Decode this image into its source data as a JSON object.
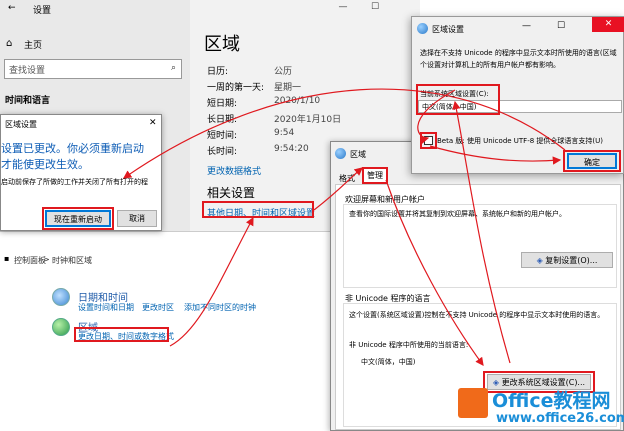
{
  "settings": {
    "title": "设置",
    "home": "主页",
    "search_placeholder": "查找设置",
    "section": "时间和语言",
    "region_title": "区域",
    "rows": [
      {
        "label": "日历:",
        "value": "公历"
      },
      {
        "label": "一周的第一天:",
        "value": "星期一"
      },
      {
        "label": "短日期:",
        "value": "2020/1/10"
      },
      {
        "label": "长日期:",
        "value": "2020年1月10日"
      },
      {
        "label": "短时间:",
        "value": "9:54"
      },
      {
        "label": "长时间:",
        "value": "9:54:20"
      }
    ],
    "change_format": "更改数据格式",
    "related_title": "相关设置",
    "related_link": "其他日期、时间和区域设置",
    "window_buttons": {
      "minimize": "—",
      "maximize": "☐"
    }
  },
  "alert": {
    "title": "区域设置",
    "message_line1": "设置已更改。你必须重新启动",
    "message_line2": "才能使更改生效。",
    "note": "启动前保存了所做的工作并关闭了所有打开的程",
    "restart_label": "现在重新启动",
    "cancel_label": "取消",
    "close": "✕"
  },
  "control_panel": {
    "breadcrumb_1": "控制面板",
    "breadcrumb_sep": ">",
    "breadcrumb_2": "时钟和区域",
    "datetime_title": "日期和时间",
    "datetime_links": [
      "设置时间和日期",
      "更改时区",
      "添加不同时区的时钟"
    ],
    "region_title": "区域",
    "region_link": "更改日期、时间或数字格式"
  },
  "region_dialog": {
    "title": "区域",
    "tabs": [
      "格式",
      "管理"
    ],
    "welcome_title": "欢迎屏幕和新用户帐户",
    "welcome_desc": "查看你的国际设置并将其复制到欢迎屏幕、系统帐户和新的用户帐户。",
    "copy_button": "复制设置(O)...",
    "unicode_title": "非 Unicode 程序的语言",
    "unicode_desc": "这个设置(系统区域设置)控制在不支持 Unicode 的程序中显示文本时使用的语言。",
    "current_label": "非 Unicode 程序中所使用的当前语言:",
    "current_value": "中文(简体，中国)",
    "change_button": "更改系统区域设置(C)..."
  },
  "unicode_dialog": {
    "title": "区域设置",
    "desc_line1": "选择在不支持 Unicode 的程序中显示文本时所使用的语言(区域",
    "desc_line2": "个设置对计算机上的所有用户帐户都有影响。",
    "current_label": "当前系统区域设置(C):",
    "current_value": "中文(简体，中国)",
    "beta_label": "Beta 版: 使用 Unicode UTF-8 提供全球语言支持(U)",
    "ok_label": "确定",
    "controls": {
      "minimize": "—",
      "maximize": "☐"
    }
  },
  "watermark": {
    "brand": "Office教程网",
    "url": "www.office26.com"
  },
  "colors": {
    "annotation": "#e0191f",
    "link": "#0063b1",
    "brand": "#1a8ed8"
  }
}
